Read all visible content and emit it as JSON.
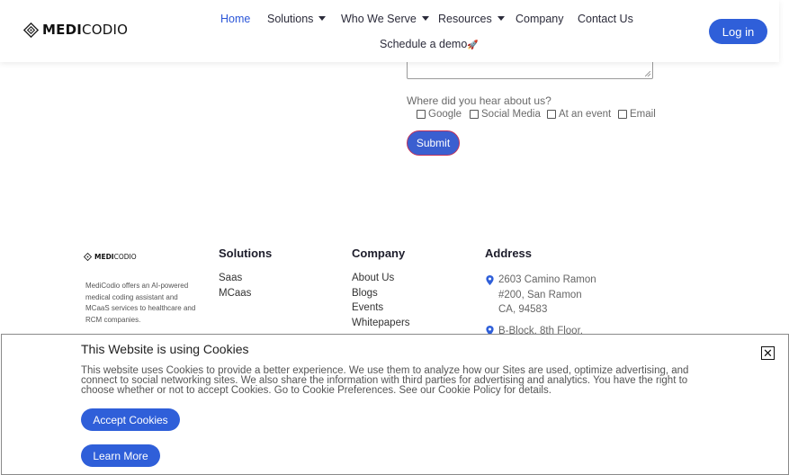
{
  "header": {
    "logo_bold": "MEDI",
    "logo_rest": "CODIO",
    "nav": [
      {
        "label": "Home"
      },
      {
        "label": "Solutions"
      },
      {
        "label": "Who We Serve"
      },
      {
        "label": "Resources"
      },
      {
        "label": "Company"
      },
      {
        "label": "Contact Us"
      }
    ],
    "demo_label": "Schedule a demo",
    "demo_emoji": "🚀",
    "login_label": "Log in",
    "accent_color": "#2f5fd9"
  },
  "form": {
    "hear_label": "Where did you hear about us?",
    "options": [
      "Google",
      "Social Media",
      "At an event",
      "Email"
    ],
    "submit_label": "Submit"
  },
  "footer": {
    "logo_bold": "MEDI",
    "logo_rest": "CODIO",
    "description": "MediCodio offers an AI-powered medical coding assistant and MCaaS services to healthcare and RCM companies.",
    "solutions": {
      "title": "Solutions",
      "links": [
        "Saas",
        "MCaas"
      ]
    },
    "company": {
      "title": "Company",
      "links": [
        "About Us",
        "Blogs",
        "Events",
        "Whitepapers"
      ]
    },
    "address": {
      "title": "Address",
      "line1": "2603 Camino Ramon",
      "line2": "#200, San Ramon",
      "line3": "CA, 94583",
      "line4": "B-Block, 8th Floor,"
    }
  },
  "cookie": {
    "title": "This Website is using Cookies",
    "text": "This website uses Cookies to provide a better experience. We use them to analyze how our Sites are used, optimize advertising, and connect to social networking sites. We also share the information with third parties for advertising and analytics. You have the right to choose whether or not to accept Cookies. Go to Cookie Preferences. See our Cookie Policy for details.",
    "accept_label": "Accept Cookies",
    "learn_label": "Learn More",
    "close_glyph": "✕"
  }
}
